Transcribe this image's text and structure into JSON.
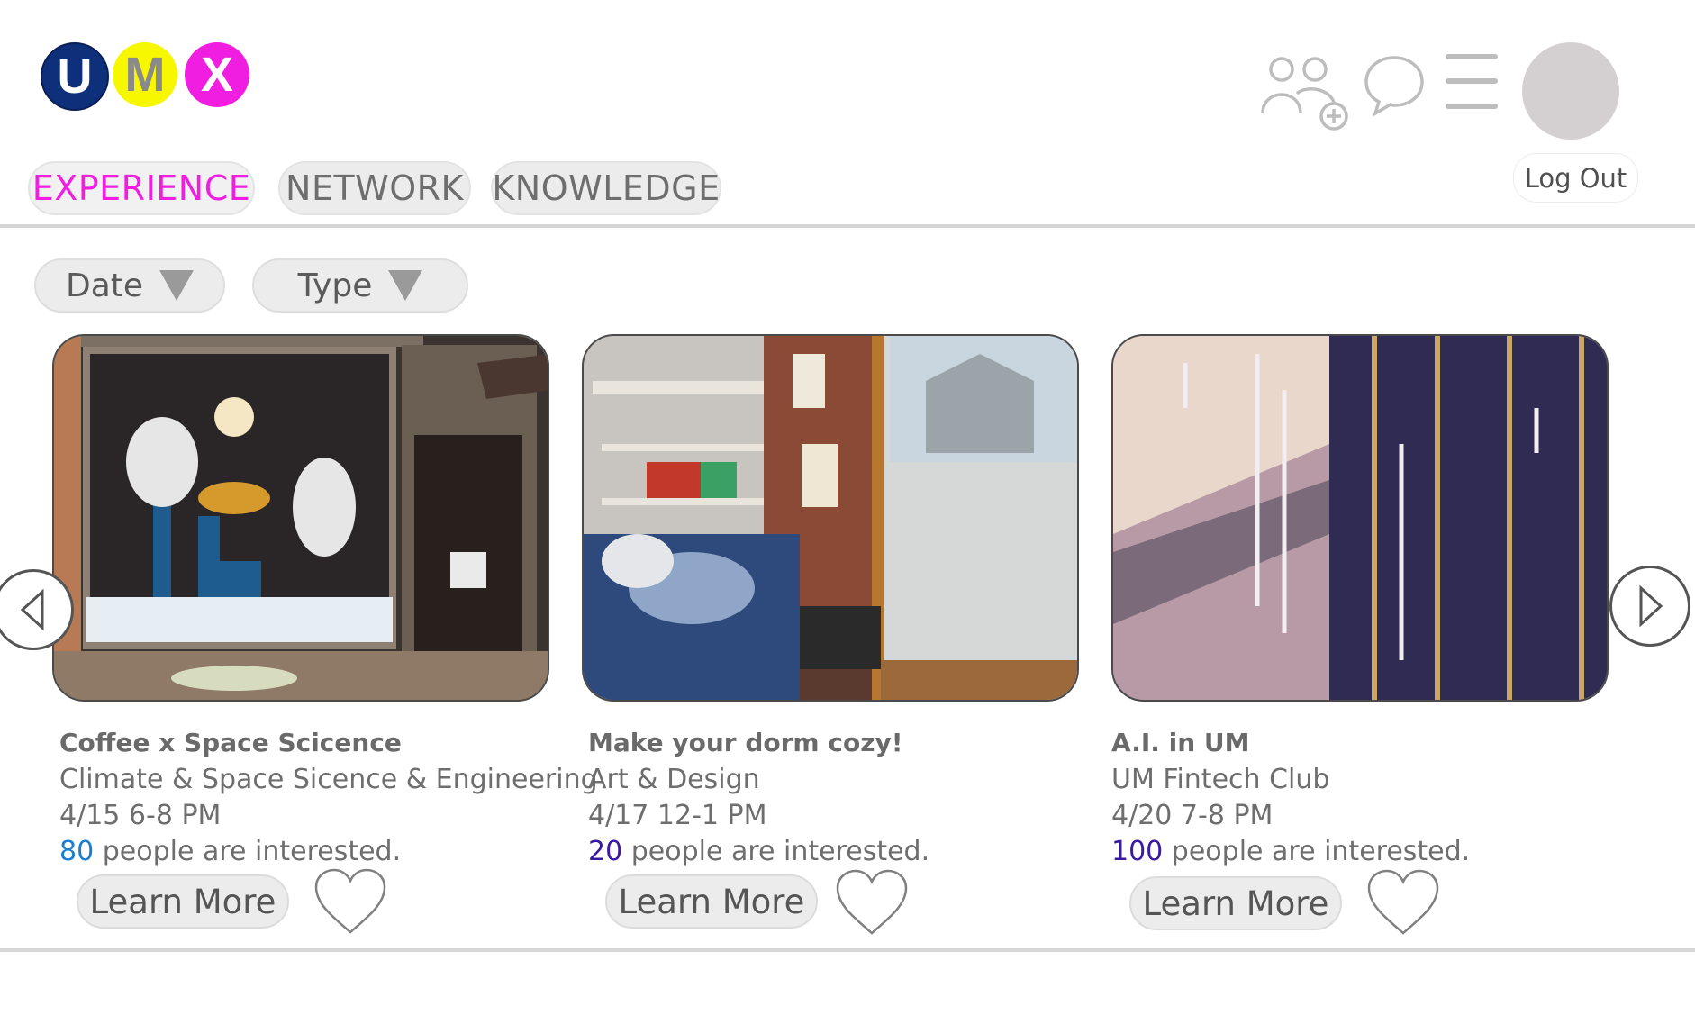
{
  "logo": {
    "letters": [
      "U",
      "M",
      "X"
    ],
    "colors": [
      "#0e2f7a",
      "#f7f700",
      "#f01ee0"
    ],
    "text_colors": [
      "#ffffff",
      "#8a8a8a",
      "#ffffff"
    ]
  },
  "header": {
    "icons": [
      "add-people-icon",
      "chat-icon",
      "menu-icon"
    ],
    "logout_label": "Log Out"
  },
  "tabs": [
    {
      "label": "EXPERIENCE",
      "active": true
    },
    {
      "label": "NETWORK",
      "active": false
    },
    {
      "label": "KNOWLEDGE",
      "active": false
    }
  ],
  "active_tab_color": "#f01ee0",
  "filters": [
    {
      "label": "Date"
    },
    {
      "label": "Type"
    }
  ],
  "cards": [
    {
      "title": "Coffee x Space Scicence",
      "category": "Climate & Space Sicence & Engineering",
      "time": "4/15 6-8 PM",
      "count": "80",
      "count_color": "#1a7fd0",
      "interest_text": " people are interested.",
      "button_label": "Learn More",
      "image": "coffee-shop-window-illustration"
    },
    {
      "title": "Make your dorm cozy!",
      "category": "Art & Design",
      "time": "4/17 12-1 PM",
      "count": "20",
      "count_color": "#3a1aa0",
      "interest_text": " people are interested.",
      "button_label": "Learn More",
      "image": "cozy-room-corner"
    },
    {
      "title": "A.I. in UM",
      "category": "UM Fintech Club",
      "time": "4/20 7-8 PM",
      "count": "100",
      "count_color": "#3a1aa0",
      "interest_text": " people are interested.",
      "button_label": "Learn More",
      "image": "glass-building-interior"
    }
  ]
}
